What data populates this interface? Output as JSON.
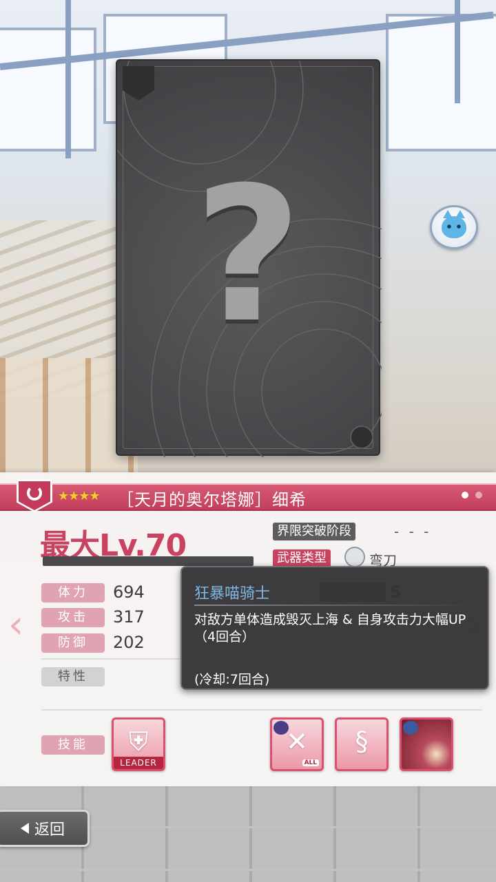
{
  "card": {
    "placeholder_glyph": "?"
  },
  "info": {
    "rarity_stars": "★★★★",
    "card_name": "［天月的奥尔塔娜］细希",
    "max_level": "最大Lv.70",
    "level_bar_fraction": 0.0,
    "limit_break_label": "界限突破阶段",
    "limit_break_value": "- - -",
    "weapon_type_label": "武器类型",
    "weapon_type_value": "弯刀",
    "hidden_value": "5",
    "stats": [
      {
        "label": "体力",
        "value": "694"
      },
      {
        "label": "攻击",
        "value": "317"
      },
      {
        "label": "防御",
        "value": "202"
      }
    ],
    "trait_label": "特性",
    "skill_label": "技能",
    "leader_badge": "LEADER",
    "all_badge": "ALL"
  },
  "tooltip": {
    "title": "狂暴喵骑士",
    "description": "对敌方单体造成毁灭上海 & 自身攻击力大幅UP（4回合）",
    "cooldown": "(冷却:7回合)"
  },
  "nav": {
    "back_label": "返回",
    "prev_arrow": "‹",
    "next_arrow": "›"
  },
  "colors": {
    "accent": "#c33f5c",
    "tooltip_bg": "#343437",
    "tooltip_title": "#7fb9e3"
  }
}
